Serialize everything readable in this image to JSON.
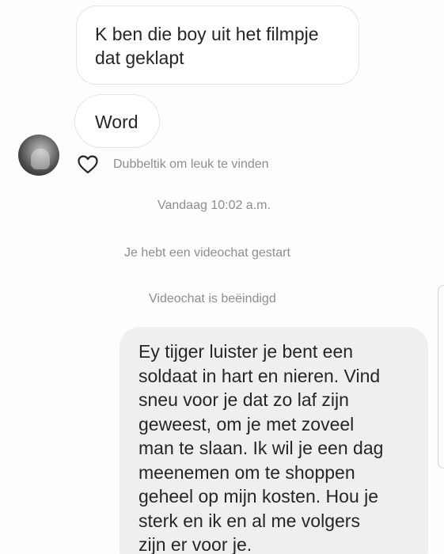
{
  "messages": [
    {
      "direction": "incoming",
      "lines": [
        "K ben die boy uit het filmpje",
        "dat geklapt"
      ]
    },
    {
      "direction": "incoming",
      "lines": [
        "Word"
      ]
    }
  ],
  "like_hint": {
    "icon": "heart-outline-icon",
    "text": "Dubbeltik om leuk te vinden"
  },
  "timestamp": "Vandaag 10:02 a.m.",
  "system_messages": [
    "Je hebt een videochat gestart",
    "Videochat is beëindigd"
  ],
  "outgoing_message": {
    "direction": "outgoing",
    "lines": [
      "Ey tijger luister je bent een",
      "soldaat in hart en nieren. Vind",
      "sneu voor je dat zo laf zijn",
      "geweest, om je met zoveel",
      "man te slaan. Ik wil je een dag",
      "meenemen om te shoppen",
      "geheel op mijn kosten. Hou je",
      "sterk en ik en al me volgers",
      "zijn er voor je."
    ]
  },
  "colors": {
    "incoming_bubble_bg": "#ffffff",
    "incoming_bubble_border": "#e4e4e4",
    "outgoing_bubble_bg": "#efefef",
    "text": "#262626",
    "secondary_text": "#8e8e8e"
  }
}
